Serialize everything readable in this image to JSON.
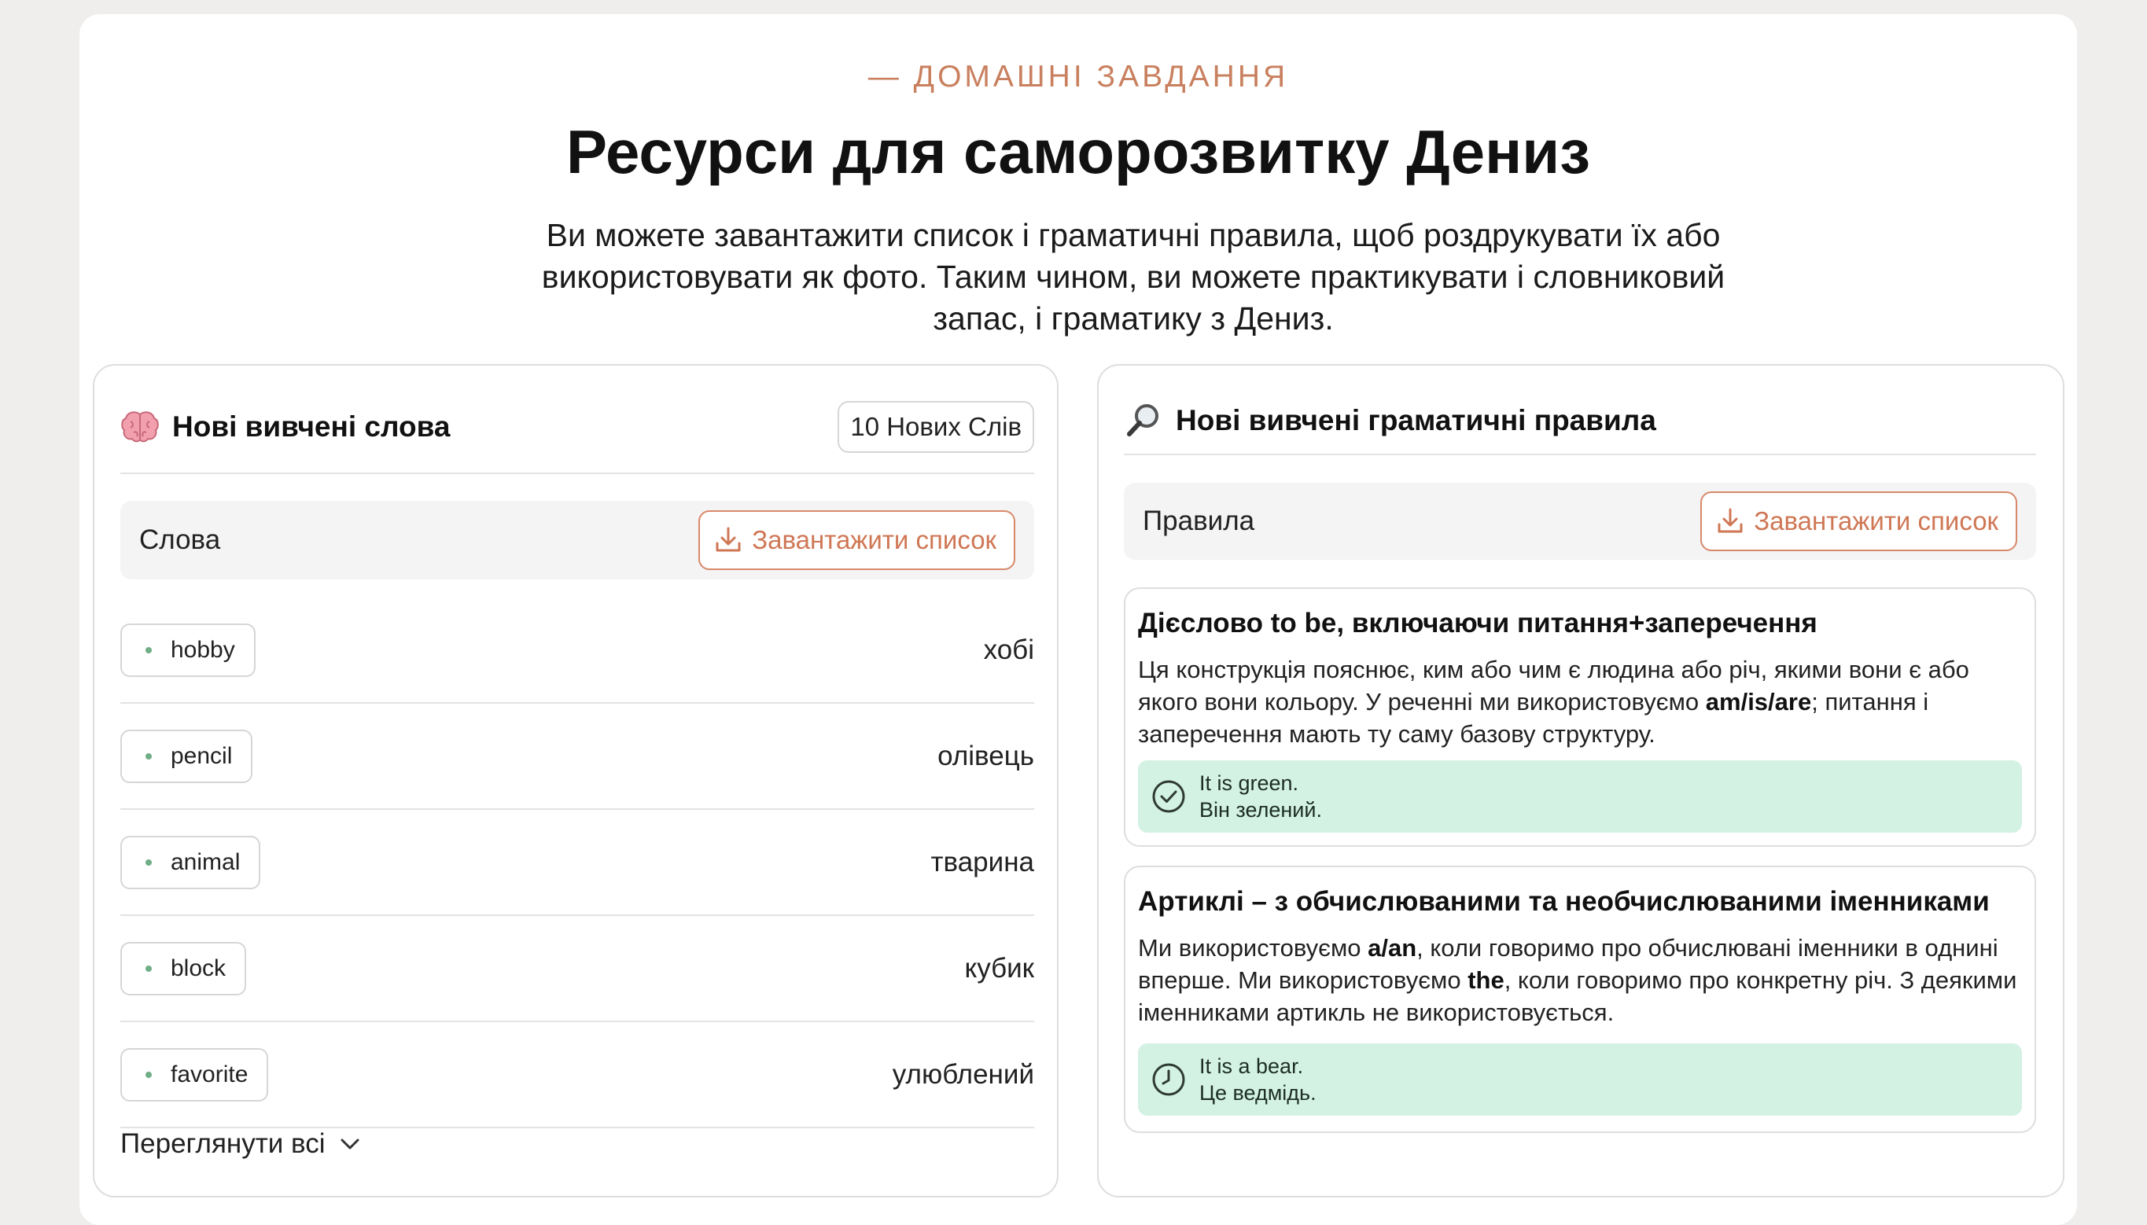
{
  "header": {
    "eyebrow": "— ДОМАШНІ ЗАВДАННЯ",
    "title": "Ресурси для саморозвитку Дениз",
    "subtitle": "Ви можете завантажити список і граматичні правила, щоб роздрукувати їх або використовувати як фото. Таким чином, ви можете практикувати і словниковий запас, і граматику з Дениз."
  },
  "words_card": {
    "icon": "brain-icon",
    "title": "Нові вивчені слова",
    "count_badge": "10 Нових Слів",
    "bar_label": "Слова",
    "download_label": "Завантажити список",
    "words": [
      {
        "en": "hobby",
        "uk": "хобі"
      },
      {
        "en": "pencil",
        "uk": "олівець"
      },
      {
        "en": "animal",
        "uk": "тварина"
      },
      {
        "en": "block",
        "uk": "кубик"
      },
      {
        "en": "favorite",
        "uk": "улюблений"
      }
    ],
    "view_all": "Переглянути всі"
  },
  "grammar_card": {
    "icon": "magnifier-icon",
    "title": "Нові вивчені граматичні правила",
    "bar_label": "Правила",
    "download_label": "Завантажити список",
    "rules": [
      {
        "title": "Дієслово to be, включаючи питання+заперечення",
        "desc_parts": [
          "Ця конструкція пояснює, ким або чим є людина або річ, якими вони є або якого вони кольору. У реченні ми використовуємо ",
          "am/is/are",
          "; питання і заперечення мають ту саму базову структуру."
        ],
        "example_en": "It is green.",
        "example_uk": "Він зелений.",
        "example_icon": "check-circle-icon"
      },
      {
        "title": "Артиклі – з обчислюваними та необчислюваними іменниками",
        "desc_parts": [
          "Ми використовуємо ",
          "a/an",
          ", коли говоримо про обчислювані іменники в однині вперше. Ми використовуємо ",
          "the",
          ", коли говоримо про конкретну річ. З деякими іменниками артикль не використовується."
        ],
        "example_en": "It is a bear.",
        "example_uk": "Це ведмідь.",
        "example_icon": "clock-icon"
      }
    ]
  },
  "colors": {
    "accent": "#cf7755",
    "example_bg": "#d3f2e3",
    "dot": "#6fae87"
  }
}
